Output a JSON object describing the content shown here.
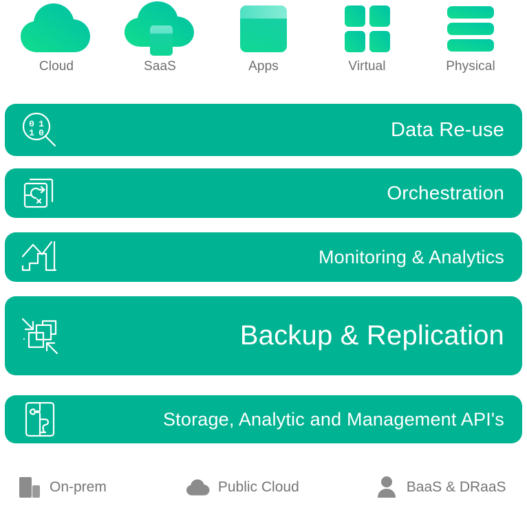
{
  "workloads": {
    "items": [
      {
        "label": "Cloud",
        "icon": "cloud-icon"
      },
      {
        "label": "SaaS",
        "icon": "cloud-app-icon"
      },
      {
        "label": "Apps",
        "icon": "app-window-icon"
      },
      {
        "label": "Virtual",
        "icon": "grid-four-squares-icon"
      },
      {
        "label": "Physical",
        "icon": "server-stack-icon"
      }
    ]
  },
  "stack": {
    "bars": [
      {
        "label": "Data Re-use",
        "icon": "binary-magnifier-icon"
      },
      {
        "label": "Orchestration",
        "icon": "workflow-arrow-icon"
      },
      {
        "label": "Monitoring & Analytics",
        "icon": "bar-chart-line-icon"
      },
      {
        "label": "Backup & Replication",
        "icon": "replication-arrows-icon"
      },
      {
        "label": "Storage, Analytic and Management API's",
        "icon": "puzzle-piece-icon"
      }
    ]
  },
  "legend": {
    "items": [
      {
        "label": "On-prem",
        "icon": "building-icon"
      },
      {
        "label": "Public Cloud",
        "icon": "cloud-solid-icon"
      },
      {
        "label": "BaaS & DRaaS",
        "icon": "person-icon"
      }
    ]
  },
  "colors": {
    "bar_teal": "#00b392",
    "icon_gradient_start": "#0ed392",
    "icon_gradient_end": "#00c9a0",
    "label_gray": "#6e6e6e",
    "legend_gray": "#8c8c8c",
    "bar_text": "#ffffff"
  }
}
